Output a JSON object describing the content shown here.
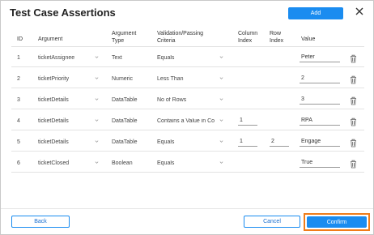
{
  "dialog": {
    "title": "Test Case Assertions",
    "add_label": "Add",
    "close_icon": "close-icon"
  },
  "columns": {
    "id": "ID",
    "argument": "Argument",
    "argument_type_1": "Argument",
    "argument_type_2": "Type",
    "validation_1": "Validation/Passing",
    "validation_2": "Criteria",
    "column_index_1": "Column",
    "column_index_2": "Index",
    "row_index_1": "Row",
    "row_index_2": "Index",
    "value": "Value"
  },
  "rows": [
    {
      "id": "1",
      "argument": "ticketAssignee",
      "type": "Text",
      "criteria": "Equals",
      "column_index": "",
      "row_index": "",
      "value": "Peter"
    },
    {
      "id": "2",
      "argument": "ticketPriority",
      "type": "Numeric",
      "criteria": "Less Than",
      "column_index": "",
      "row_index": "",
      "value": "2"
    },
    {
      "id": "3",
      "argument": "ticketDetails",
      "type": "DataTable",
      "criteria": "No of Rows",
      "column_index": "",
      "row_index": "",
      "value": "3"
    },
    {
      "id": "4",
      "argument": "ticketDetails",
      "type": "DataTable",
      "criteria": "Contains a Value in Co",
      "column_index": "1",
      "row_index": "",
      "value": "RPA"
    },
    {
      "id": "5",
      "argument": "ticketDetails",
      "type": "DataTable",
      "criteria": "Equals",
      "column_index": "1",
      "row_index": "2",
      "value": "Engage"
    },
    {
      "id": "6",
      "argument": "ticketClosed",
      "type": "Boolean",
      "criteria": "Equals",
      "column_index": "",
      "row_index": "",
      "value": "True"
    }
  ],
  "footer": {
    "back_label": "Back",
    "cancel_label": "Cancel",
    "confirm_label": "Confirm"
  },
  "colors": {
    "primary": "#1a8cf0",
    "highlight": "#f07d1a"
  }
}
